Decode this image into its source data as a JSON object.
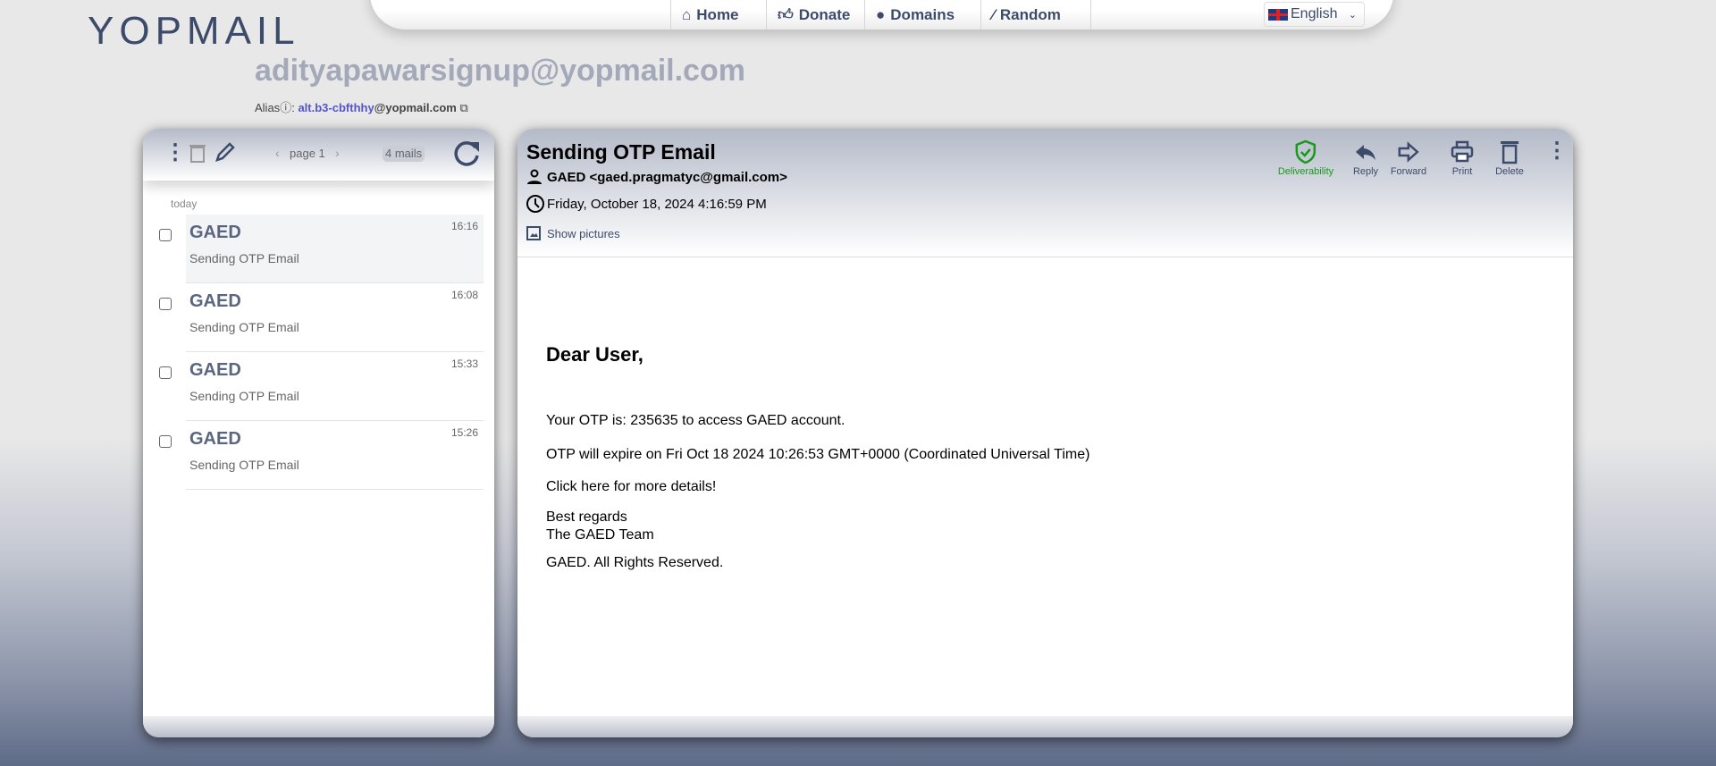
{
  "logo": {
    "text": "YOPMAIL"
  },
  "nav": {
    "items": [
      {
        "label": "Home",
        "icon": "home-icon"
      },
      {
        "label": "Donate",
        "icon": "thumbs-up-icon"
      },
      {
        "label": "Domains",
        "icon": "globe-icon"
      },
      {
        "label": "Random",
        "icon": "magic-wand-icon"
      }
    ],
    "language": "English"
  },
  "inbox": {
    "address": "adityapawarsignup@yopmail.com",
    "alias_label": "Alias",
    "alias_sep": ":",
    "alias_user": "alt.b3-cbfthhy",
    "alias_domain": "@yopmail.com"
  },
  "list": {
    "page": "page 1",
    "count": "4 mails",
    "group": "today",
    "mails": [
      {
        "sender": "GAED",
        "subject": "Sending OTP Email",
        "time": "16:16"
      },
      {
        "sender": "GAED",
        "subject": "Sending OTP Email",
        "time": "16:08"
      },
      {
        "sender": "GAED",
        "subject": "Sending OTP Email",
        "time": "15:33"
      },
      {
        "sender": "GAED",
        "subject": "Sending OTP Email",
        "time": "15:26"
      }
    ]
  },
  "message": {
    "subject": "Sending OTP Email",
    "from": "GAED <gaed.pragmatyc@gmail.com>",
    "date": "Friday, October 18, 2024 4:16:59 PM",
    "show_pictures": "Show pictures",
    "actions": {
      "deliverability": "Deliverability",
      "reply": "Reply",
      "forward": "Forward",
      "print": "Print",
      "delete": "Delete"
    },
    "body": {
      "greeting": "Dear User,",
      "otp": "Your OTP is: 235635 to access GAED account.",
      "expire": "OTP will expire on Fri Oct 18 2024 10:26:53 GMT+0000 (Coordinated Universal Time)",
      "link": "Click here for more details!",
      "regards": "Best regards",
      "team": "The GAED Team",
      "rights": "GAED. All Rights Reserved."
    }
  },
  "colors": {
    "accent": "#3d4b6b",
    "deliverability": "#1a9a1a"
  }
}
